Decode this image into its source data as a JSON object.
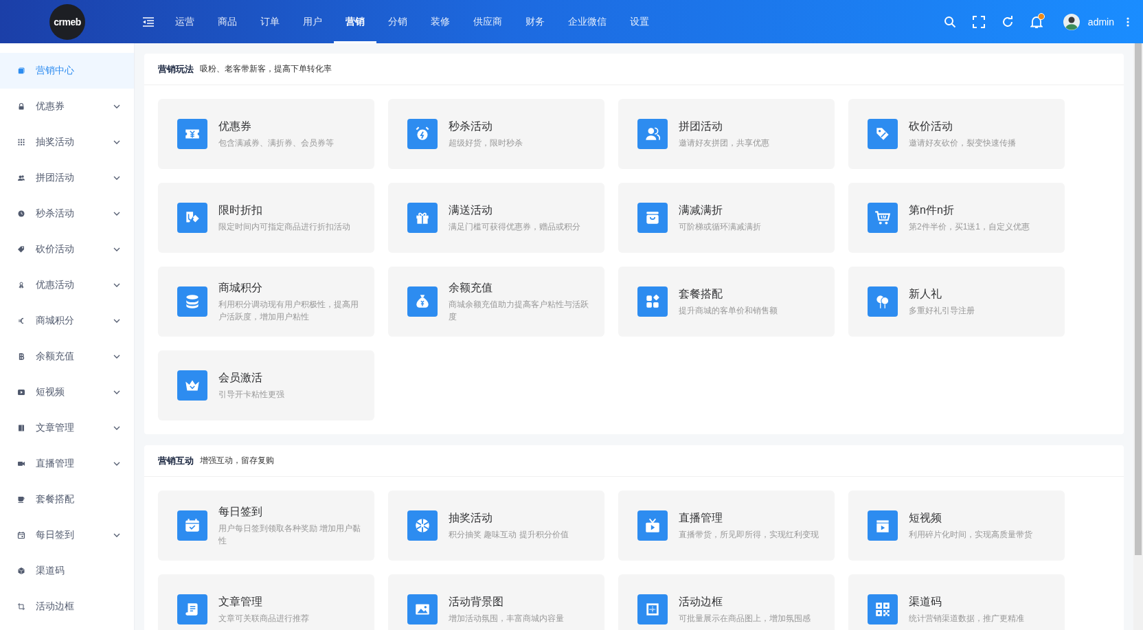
{
  "header": {
    "logo": "crmeb",
    "nav": [
      {
        "label": "运营",
        "selected": false
      },
      {
        "label": "商品",
        "selected": false
      },
      {
        "label": "订单",
        "selected": false
      },
      {
        "label": "用户",
        "selected": false
      },
      {
        "label": "营销",
        "selected": true
      },
      {
        "label": "分销",
        "selected": false
      },
      {
        "label": "装修",
        "selected": false
      },
      {
        "label": "供应商",
        "selected": false
      },
      {
        "label": "财务",
        "selected": false
      },
      {
        "label": "企业微信",
        "selected": false
      },
      {
        "label": "设置",
        "selected": false
      }
    ],
    "notification_dot": true,
    "user": "admin"
  },
  "sidebar": {
    "items": [
      {
        "label": "营销中心",
        "selected": true,
        "expandable": false
      },
      {
        "label": "优惠券",
        "selected": false,
        "expandable": true
      },
      {
        "label": "抽奖活动",
        "selected": false,
        "expandable": true
      },
      {
        "label": "拼团活动",
        "selected": false,
        "expandable": true
      },
      {
        "label": "秒杀活动",
        "selected": false,
        "expandable": true
      },
      {
        "label": "砍价活动",
        "selected": false,
        "expandable": true
      },
      {
        "label": "优惠活动",
        "selected": false,
        "expandable": true
      },
      {
        "label": "商城积分",
        "selected": false,
        "expandable": true
      },
      {
        "label": "余额充值",
        "selected": false,
        "expandable": true
      },
      {
        "label": "短视频",
        "selected": false,
        "expandable": true
      },
      {
        "label": "文章管理",
        "selected": false,
        "expandable": true
      },
      {
        "label": "直播管理",
        "selected": false,
        "expandable": true
      },
      {
        "label": "套餐搭配",
        "selected": false,
        "expandable": false
      },
      {
        "label": "每日签到",
        "selected": false,
        "expandable": true
      },
      {
        "label": "渠道码",
        "selected": false,
        "expandable": false
      },
      {
        "label": "活动边框",
        "selected": false,
        "expandable": false
      }
    ]
  },
  "sections": [
    {
      "title": "营销玩法",
      "subtitle": "吸粉、老客带新客，提高下单转化率",
      "cards": [
        {
          "title": "优惠券",
          "description": "包含满减券、满折券、会员券等"
        },
        {
          "title": "秒杀活动",
          "description": "超级好货，限时秒杀"
        },
        {
          "title": "拼团活动",
          "description": "邀请好友拼团，共享优惠"
        },
        {
          "title": "砍价活动",
          "description": "邀请好友砍价，裂变快速传播"
        },
        {
          "title": "限时折扣",
          "description": "限定时间内可指定商品进行折扣活动"
        },
        {
          "title": "满送活动",
          "description": "满足门槛可获得优惠券，赠品或积分"
        },
        {
          "title": "满减满折",
          "description": "可阶梯或循环满减满折"
        },
        {
          "title": "第n件n折",
          "description": "第2件半价，买1送1，自定义优惠"
        },
        {
          "title": "商城积分",
          "description": "利用积分调动现有用户积极性，提高用户活跃度，增加用户粘性"
        },
        {
          "title": "余额充值",
          "description": "商城余额充值助力提高客户粘性与活跃度"
        },
        {
          "title": "套餐搭配",
          "description": "提升商城的客单价和销售额"
        },
        {
          "title": "新人礼",
          "description": "多重好礼引导注册"
        },
        {
          "title": "会员激活",
          "description": "引导开卡粘性更强"
        }
      ]
    },
    {
      "title": "营销互动",
      "subtitle": "增强互动，留存复购",
      "cards": [
        {
          "title": "每日签到",
          "description": "用户每日签到领取各种奖励 增加用户黏性"
        },
        {
          "title": "抽奖活动",
          "description": "积分抽奖 趣味互动 提升积分价值"
        },
        {
          "title": "直播管理",
          "description": "直播带货，所见即所得，实现红利变现"
        },
        {
          "title": "短视频",
          "description": "利用碎片化时间，实现高质量带货"
        },
        {
          "title": "文章管理",
          "description": "文章可关联商品进行推荐"
        },
        {
          "title": "活动背景图",
          "description": "增加活动氛围，丰富商城内容量"
        },
        {
          "title": "活动边框",
          "description": "可批量展示在商品图上，增加氛围感"
        },
        {
          "title": "渠道码",
          "description": "统计营销渠道数据，推广更精准"
        }
      ]
    }
  ]
}
